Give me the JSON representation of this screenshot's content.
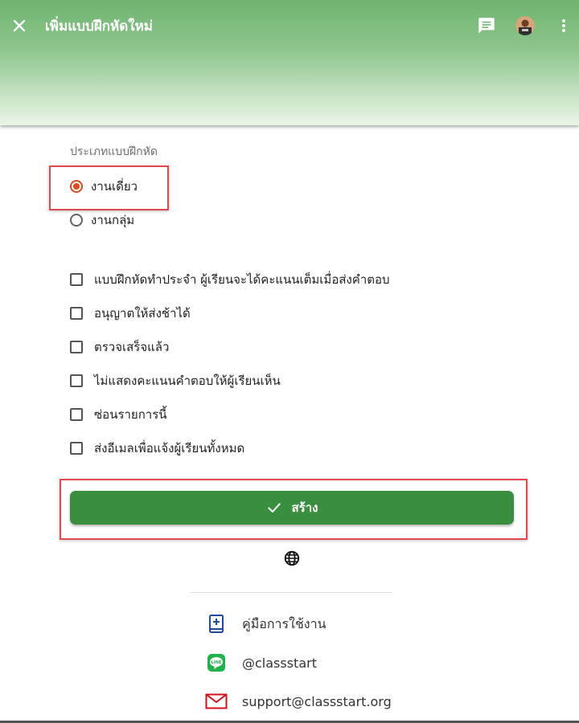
{
  "header": {
    "title": "เพิ่มแบบฝึกหัดใหม่",
    "icons": [
      "close-icon",
      "chat-icon",
      "avatar",
      "more-vert-icon"
    ]
  },
  "form": {
    "section_label": "ประเภทแบบฝึกหัด",
    "radios": [
      {
        "label": "งานเดี่ยว",
        "checked": true
      },
      {
        "label": "งานกลุ่ม",
        "checked": false
      }
    ],
    "checkboxes": [
      {
        "label": "แบบฝึกหัดทำประจำ ผู้เรียนจะได้คะแนนเต็มเมื่อส่งคำตอบ",
        "checked": false
      },
      {
        "label": "อนุญาตให้ส่งช้าได้",
        "checked": false
      },
      {
        "label": "ตรวจเสร็จแล้ว",
        "checked": false
      },
      {
        "label": "ไม่แสดงคะแนนคำตอบให้ผู้เรียนเห็น",
        "checked": false
      },
      {
        "label": "ซ่อนรายการนี้",
        "checked": false
      },
      {
        "label": "ส่งอีเมลเพื่อแจ้งผู้เรียนทั้งหมด",
        "checked": false
      }
    ],
    "create_label": "สร้าง"
  },
  "footer": {
    "links": [
      {
        "label": "คู่มือการใช้งาน",
        "icon": "manual-book-icon"
      },
      {
        "label": "@classstart",
        "icon": "line-icon"
      },
      {
        "label": "support@classstart.org",
        "icon": "mail-icon"
      }
    ]
  },
  "colors": {
    "header_green": "#6db46f",
    "button_green": "#3a8f3f",
    "radio_selected": "#e04a1a",
    "highlight_red": "#e0494f"
  }
}
